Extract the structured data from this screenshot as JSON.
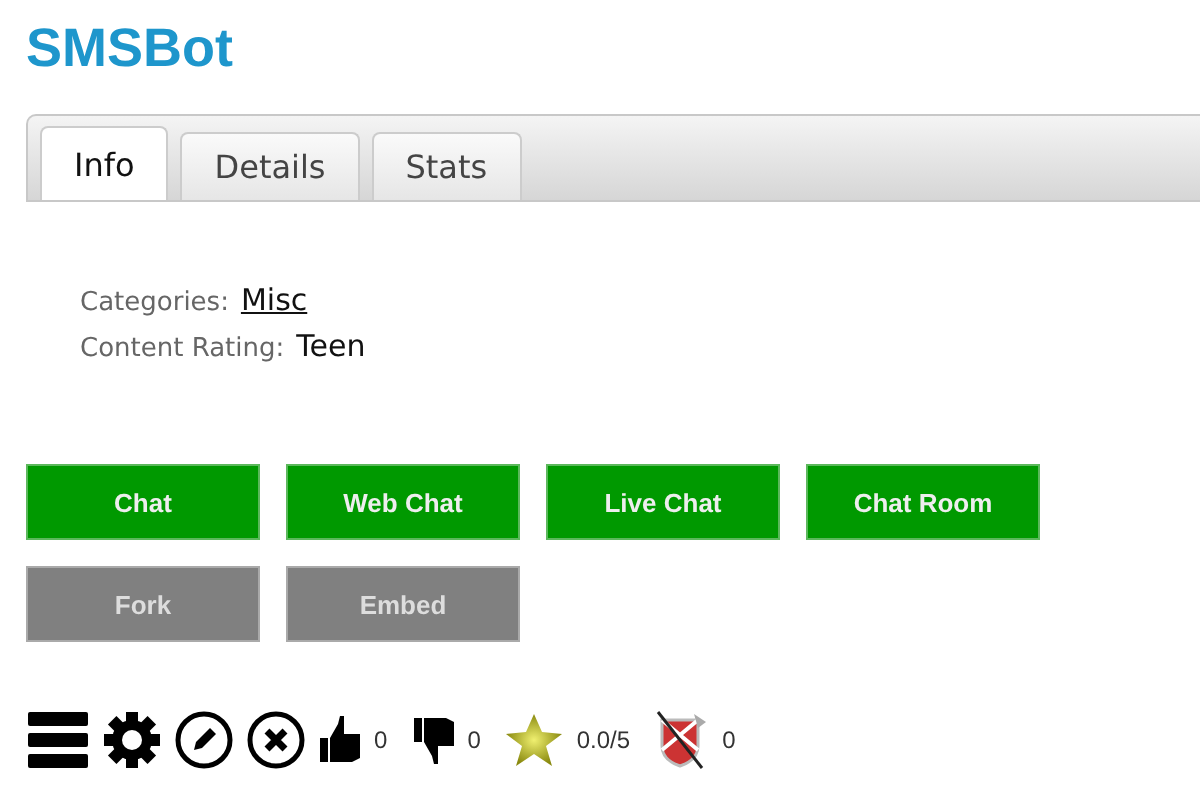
{
  "title": "SMSBot",
  "tabs": [
    {
      "label": "Info",
      "selected": true
    },
    {
      "label": "Details",
      "selected": false
    },
    {
      "label": "Stats",
      "selected": false
    }
  ],
  "info": [
    {
      "label": "Categories:",
      "value": "Misc",
      "kind": "link"
    },
    {
      "label": "Content Rating:",
      "value": "Teen",
      "kind": "text"
    }
  ],
  "buttons": [
    [
      {
        "label": "Chat",
        "disabled": false
      },
      {
        "label": "Web Chat",
        "disabled": false
      },
      {
        "label": "Live Chat",
        "disabled": false
      },
      {
        "label": "Chat Room",
        "disabled": false
      }
    ],
    [
      {
        "label": "Fork",
        "disabled": true
      },
      {
        "label": "Embed",
        "disabled": true
      }
    ]
  ],
  "toolbar": {
    "likes": "0",
    "dislikes": "0",
    "rating": "0.0/5",
    "flags": "0"
  }
}
